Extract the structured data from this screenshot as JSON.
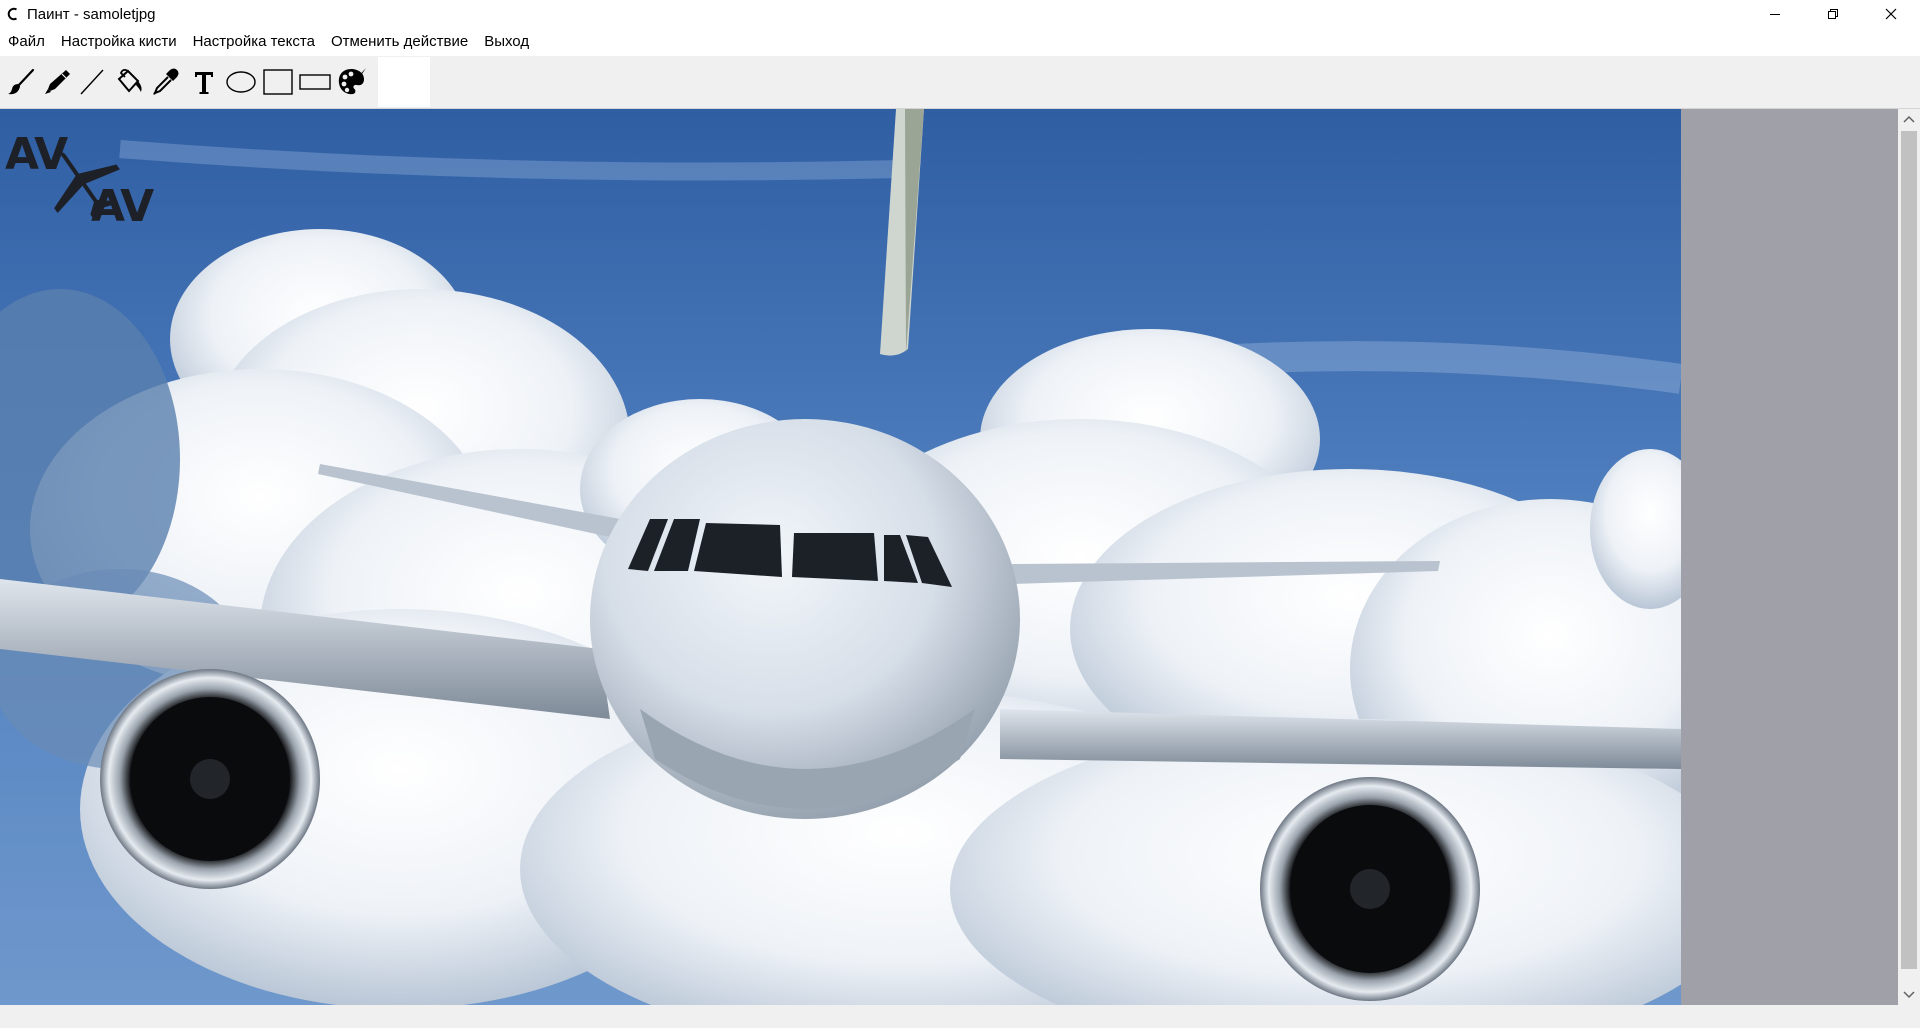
{
  "window": {
    "title": "Паинт - samoletjpg",
    "controls": [
      "minimize",
      "restore",
      "close"
    ]
  },
  "menu": {
    "items": [
      "Файл",
      "Настройка кисти",
      "Настройка текста",
      "Отменить действие",
      "Выход"
    ]
  },
  "toolbar": {
    "tools": [
      {
        "name": "brush-icon"
      },
      {
        "name": "marker-icon"
      },
      {
        "name": "line-icon"
      },
      {
        "name": "paint-bucket-icon"
      },
      {
        "name": "eyedropper-icon"
      },
      {
        "name": "text-tool-icon",
        "glyph": "T"
      },
      {
        "name": "ellipse-icon"
      },
      {
        "name": "square-icon"
      },
      {
        "name": "rectangle-icon"
      },
      {
        "name": "palette-icon"
      }
    ],
    "current_color": "#ffffff"
  },
  "canvas": {
    "background": "#a0a0a8",
    "image": "photo of a passenger jet flying towards the viewer above white cumulus clouds in a blue sky",
    "watermark": {
      "line1": "AV",
      "line2": "AV"
    }
  }
}
